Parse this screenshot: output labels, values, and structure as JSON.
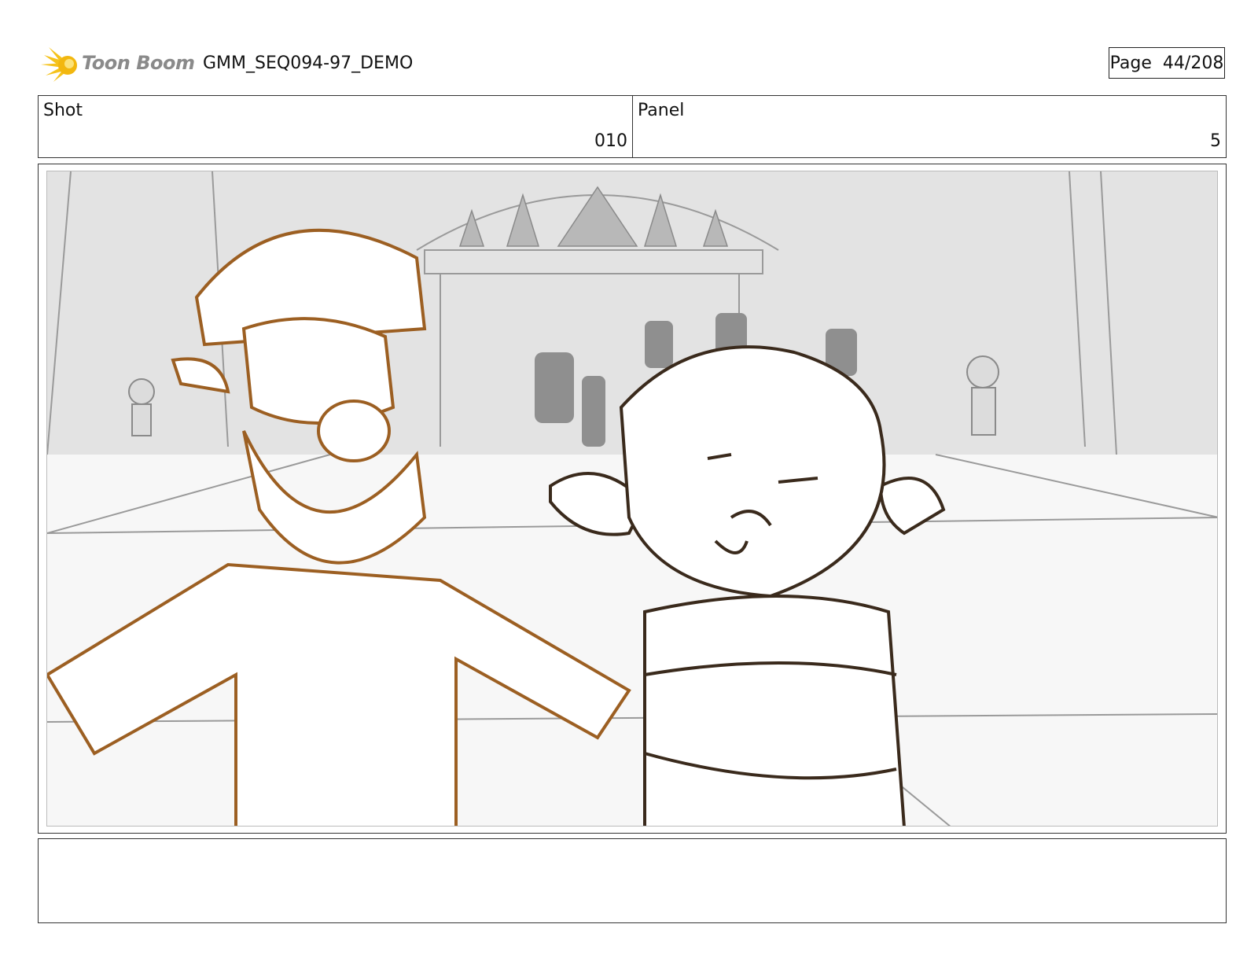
{
  "header": {
    "logo_text": "Toon Boom",
    "project_title": "GMM_SEQ094-97_DEMO",
    "page_label": "Page",
    "page_number": "44/208"
  },
  "info": {
    "shot_label": "Shot",
    "shot_value": "010",
    "panel_label": "Panel",
    "panel_value": "5"
  },
  "panel": {
    "image_icon": "storyboard-sketch-image",
    "colors": {
      "background_sketch": "#9a9a9a",
      "left_character": "#9c5f22",
      "right_character": "#3a2a1c"
    }
  },
  "notes": {
    "text": ""
  }
}
